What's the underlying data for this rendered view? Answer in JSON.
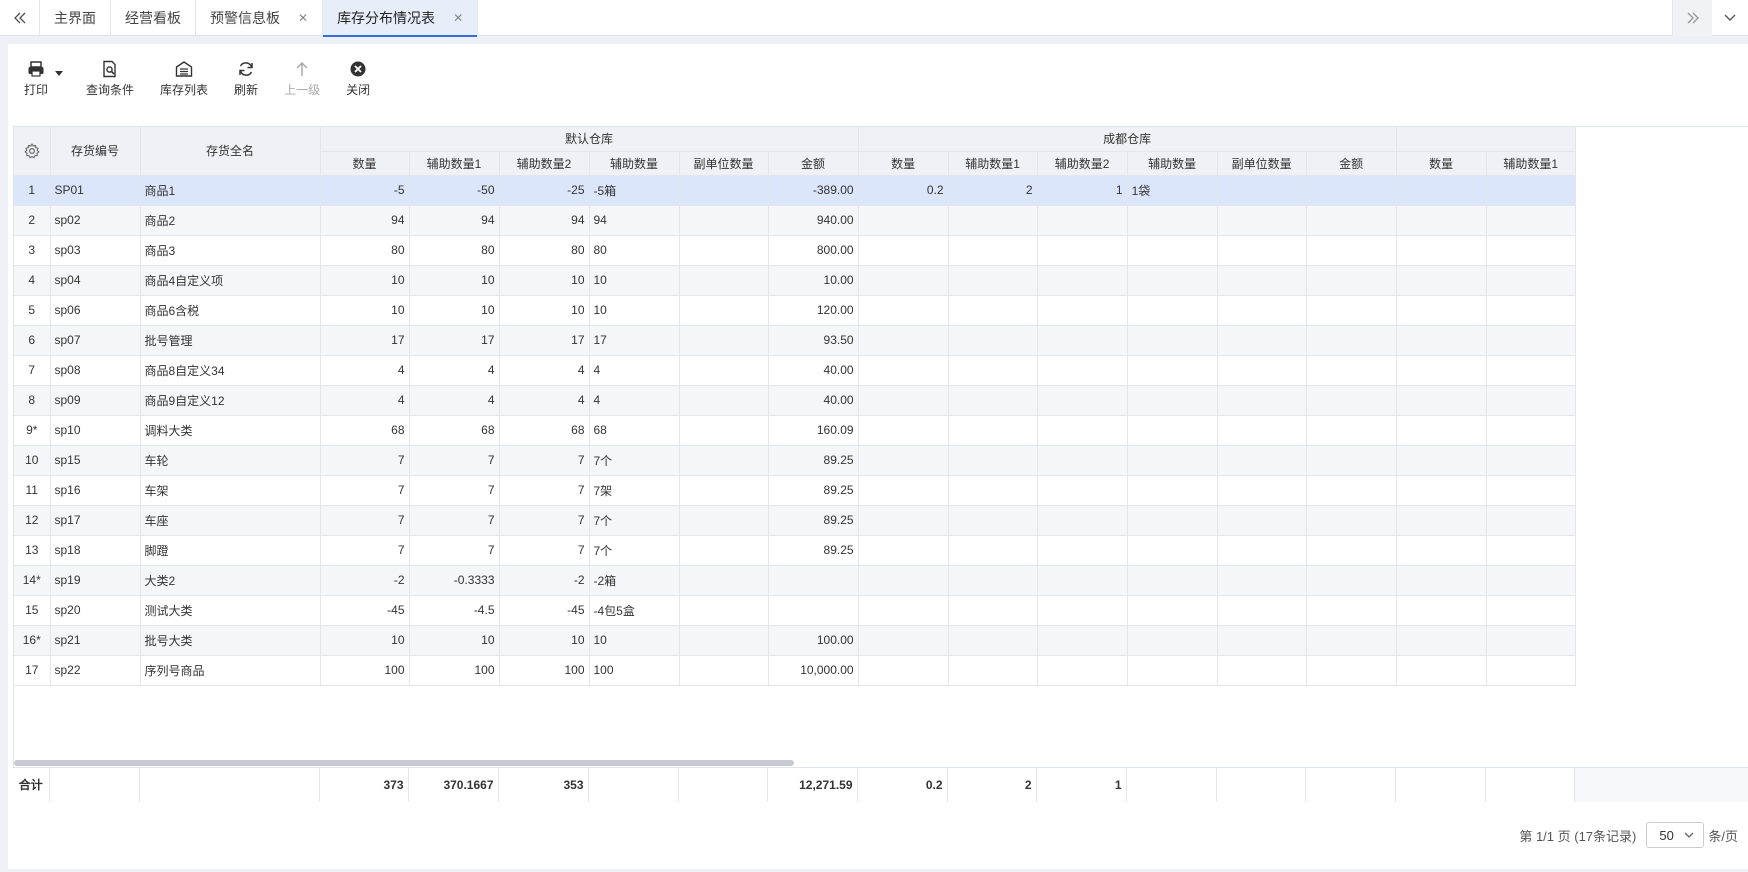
{
  "tabs": [
    {
      "label": "主界面",
      "closable": false,
      "active": false
    },
    {
      "label": "经营看板",
      "closable": false,
      "active": false
    },
    {
      "label": "预警信息板",
      "closable": true,
      "active": false
    },
    {
      "label": "库存分布情况表",
      "closable": true,
      "active": true
    }
  ],
  "toolbar": {
    "print": "打印",
    "query": "查询条件",
    "stock_list": "库存列表",
    "refresh": "刷新",
    "up_level": "上一级",
    "close": "关闭"
  },
  "table": {
    "fixed_headers": [
      "存货编号",
      "存货全名"
    ],
    "groups": [
      "默认仓库",
      "成都仓库",
      ""
    ],
    "sub_headers": [
      "数量",
      "辅助数量1",
      "辅助数量2",
      "辅助数量",
      "副单位数量",
      "金额"
    ],
    "partial_group_headers": [
      "数量",
      "辅助数量1"
    ],
    "rows": [
      {
        "idx": "1",
        "code": "SP01",
        "name": "商品1",
        "d": [
          "-5",
          "-50",
          "-25",
          "-5箱",
          "",
          "-389.00"
        ],
        "c": [
          "0.2",
          "2",
          "1",
          "1袋",
          "",
          ""
        ]
      },
      {
        "idx": "2",
        "code": "sp02",
        "name": "商品2",
        "d": [
          "94",
          "94",
          "94",
          "94",
          "",
          "940.00"
        ],
        "c": [
          "",
          "",
          "",
          "",
          "",
          ""
        ]
      },
      {
        "idx": "3",
        "code": "sp03",
        "name": "商品3",
        "d": [
          "80",
          "80",
          "80",
          "80",
          "",
          "800.00"
        ],
        "c": [
          "",
          "",
          "",
          "",
          "",
          ""
        ]
      },
      {
        "idx": "4",
        "code": "sp04",
        "name": "商品4自定义项",
        "d": [
          "10",
          "10",
          "10",
          "10",
          "",
          "10.00"
        ],
        "c": [
          "",
          "",
          "",
          "",
          "",
          ""
        ]
      },
      {
        "idx": "5",
        "code": "sp06",
        "name": "商品6含税",
        "d": [
          "10",
          "10",
          "10",
          "10",
          "",
          "120.00"
        ],
        "c": [
          "",
          "",
          "",
          "",
          "",
          ""
        ]
      },
      {
        "idx": "6",
        "code": "sp07",
        "name": "批号管理",
        "d": [
          "17",
          "17",
          "17",
          "17",
          "",
          "93.50"
        ],
        "c": [
          "",
          "",
          "",
          "",
          "",
          ""
        ]
      },
      {
        "idx": "7",
        "code": "sp08",
        "name": "商品8自定义34",
        "d": [
          "4",
          "4",
          "4",
          "4",
          "",
          "40.00"
        ],
        "c": [
          "",
          "",
          "",
          "",
          "",
          ""
        ]
      },
      {
        "idx": "8",
        "code": "sp09",
        "name": "商品9自定义12",
        "d": [
          "4",
          "4",
          "4",
          "4",
          "",
          "40.00"
        ],
        "c": [
          "",
          "",
          "",
          "",
          "",
          ""
        ]
      },
      {
        "idx": "9*",
        "code": "sp10",
        "name": "调料大类",
        "d": [
          "68",
          "68",
          "68",
          "68",
          "",
          "160.09"
        ],
        "c": [
          "",
          "",
          "",
          "",
          "",
          ""
        ]
      },
      {
        "idx": "10",
        "code": "sp15",
        "name": "车轮",
        "d": [
          "7",
          "7",
          "7",
          "7个",
          "",
          "89.25"
        ],
        "c": [
          "",
          "",
          "",
          "",
          "",
          ""
        ]
      },
      {
        "idx": "11",
        "code": "sp16",
        "name": "车架",
        "d": [
          "7",
          "7",
          "7",
          "7架",
          "",
          "89.25"
        ],
        "c": [
          "",
          "",
          "",
          "",
          "",
          ""
        ]
      },
      {
        "idx": "12",
        "code": "sp17",
        "name": "车座",
        "d": [
          "7",
          "7",
          "7",
          "7个",
          "",
          "89.25"
        ],
        "c": [
          "",
          "",
          "",
          "",
          "",
          ""
        ]
      },
      {
        "idx": "13",
        "code": "sp18",
        "name": "脚蹬",
        "d": [
          "7",
          "7",
          "7",
          "7个",
          "",
          "89.25"
        ],
        "c": [
          "",
          "",
          "",
          "",
          "",
          ""
        ]
      },
      {
        "idx": "14*",
        "code": "sp19",
        "name": "大类2",
        "d": [
          "-2",
          "-0.3333",
          "-2",
          "-2箱",
          "",
          ""
        ],
        "c": [
          "",
          "",
          "",
          "",
          "",
          ""
        ]
      },
      {
        "idx": "15",
        "code": "sp20",
        "name": "测试大类",
        "d": [
          "-45",
          "-4.5",
          "-45",
          "-4包5盒",
          "",
          ""
        ],
        "c": [
          "",
          "",
          "",
          "",
          "",
          ""
        ]
      },
      {
        "idx": "16*",
        "code": "sp21",
        "name": "批号大类",
        "d": [
          "10",
          "10",
          "10",
          "10",
          "",
          "100.00"
        ],
        "c": [
          "",
          "",
          "",
          "",
          "",
          ""
        ]
      },
      {
        "idx": "17",
        "code": "sp22",
        "name": "序列号商品",
        "d": [
          "100",
          "100",
          "100",
          "100",
          "",
          "10,000.00"
        ],
        "c": [
          "",
          "",
          "",
          "",
          "",
          ""
        ]
      }
    ],
    "totals": {
      "label": "合计",
      "d": [
        "373",
        "370.1667",
        "353",
        "",
        "",
        "12,271.59"
      ],
      "c": [
        "0.2",
        "2",
        "1",
        "",
        "",
        ""
      ]
    }
  },
  "pager": {
    "info": "第 1/1 页 (17条记录)",
    "page_size": "50",
    "unit": "条/页"
  }
}
